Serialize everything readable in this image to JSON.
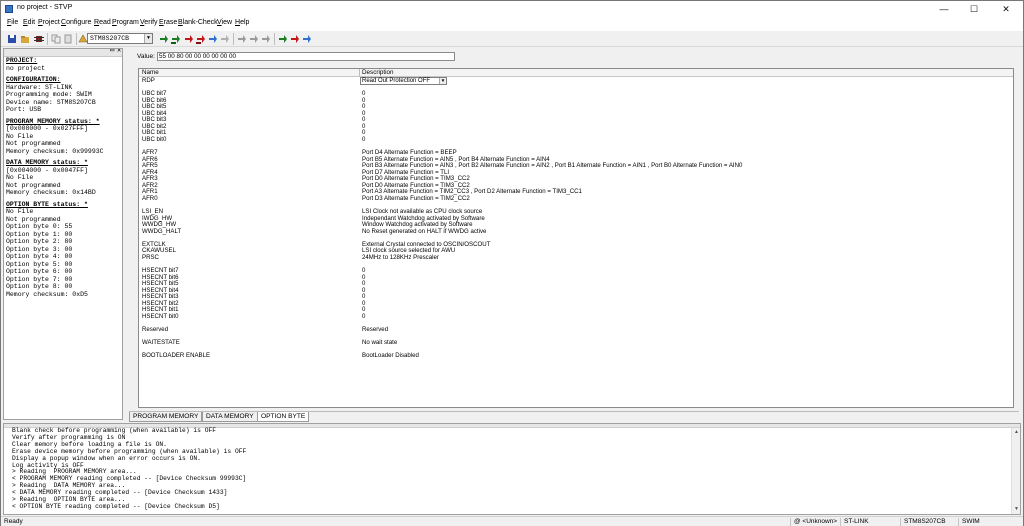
{
  "window": {
    "title": "no project - STVP",
    "min": "—",
    "max": "☐",
    "close": "✕"
  },
  "menu": [
    "File",
    "Edit",
    "Project",
    "Configure",
    "Read",
    "Program",
    "Verify",
    "Erase",
    "Blank-Check",
    "View",
    "Help"
  ],
  "toolbar": {
    "device": "STM8S207CB"
  },
  "left_pane": {
    "sections": [
      {
        "header": "PROJECT:",
        "lines": [
          "no project"
        ]
      },
      {
        "header": "CONFIGURATION:",
        "lines": [
          "Hardware: ST-LINK",
          "Programming mode: SWIM",
          "Device name: STM8S207CB",
          "Port: USB"
        ]
      },
      {
        "header": "PROGRAM MEMORY status: *",
        "lines": [
          "[0x008000 - 0x027FFF]",
          "No File",
          "Not programmed",
          "Memory checksum: 0x99993C"
        ]
      },
      {
        "header": "DATA MEMORY status: *",
        "lines": [
          "[0x004000 - 0x0047FF]",
          "No File",
          "Not programmed",
          "Memory checksum: 0x14BD"
        ]
      },
      {
        "header": "OPTION BYTE status: *",
        "lines": [
          "No File",
          "Not programmed",
          "Option byte 0: 55",
          "Option byte 1: 00",
          "Option byte 2: 80",
          "Option byte 3: 00",
          "Option byte 4: 00",
          "Option byte 5: 00",
          "Option byte 6: 00",
          "Option byte 7: 00",
          "Option byte 8: 00",
          "Memory checksum: 0xD5"
        ]
      }
    ]
  },
  "value": {
    "label": "Value:",
    "text": "55 00 80 00 00 00 00 00 00"
  },
  "grid": {
    "headers": [
      "Name",
      "Description"
    ],
    "rows": [
      {
        "name": "RDP",
        "desc": "Read Out Protection OFF",
        "combo": true
      },
      {
        "name": "",
        "desc": ""
      },
      {
        "name": "UBC bit7",
        "desc": "0"
      },
      {
        "name": "UBC bit6",
        "desc": "0"
      },
      {
        "name": "UBC bit5",
        "desc": "0"
      },
      {
        "name": "UBC bit4",
        "desc": "0"
      },
      {
        "name": "UBC bit3",
        "desc": "0"
      },
      {
        "name": "UBC bit2",
        "desc": "0"
      },
      {
        "name": "UBC bit1",
        "desc": "0"
      },
      {
        "name": "UBC bit0",
        "desc": "0"
      },
      {
        "name": "",
        "desc": ""
      },
      {
        "name": "AFR7",
        "desc": "Port D4 Alternate Function = BEEP"
      },
      {
        "name": "AFR6",
        "desc": "Port B5 Alternate Function = AIN5 , Port B4 Alternate Function = AIN4"
      },
      {
        "name": "AFR5",
        "desc": "Port B3 Alternate Function = AIN3 , Port B2 Alternate Function = AIN2 , Port B1 Alternate Function = AIN1 , Port B0 Alternate Function = AIN0"
      },
      {
        "name": "AFR4",
        "desc": "Port D7 Alternate Function = TLI"
      },
      {
        "name": "AFR3",
        "desc": "Port D0 Alternate Function = TIM3_CC2"
      },
      {
        "name": "AFR2",
        "desc": "Port D0 Alternate Function = TIM3_CC2"
      },
      {
        "name": "AFR1",
        "desc": "Port A3 Alternate Function = TIM2_CC3 , Port D2 Alternate Function = TIM3_CC1"
      },
      {
        "name": "AFR0",
        "desc": "Port D3 Alternate Function = TIM2_CC2"
      },
      {
        "name": "",
        "desc": ""
      },
      {
        "name": "LSI_EN",
        "desc": "LSI Clock not available as CPU clock source"
      },
      {
        "name": "IWDG_HW",
        "desc": "Independant Watchdog activated by Software"
      },
      {
        "name": "WWDG_HW",
        "desc": "Window Watchdog activated by Software"
      },
      {
        "name": "WWDG_HALT",
        "desc": "No Reset generated on HALT if WWDG active"
      },
      {
        "name": "",
        "desc": ""
      },
      {
        "name": "EXTCLK",
        "desc": "External Crystal connected to OSCIN/OSCOUT"
      },
      {
        "name": "CKAWUSEL",
        "desc": "LSI clock source selected for AWU"
      },
      {
        "name": "PRSC",
        "desc": "24MHz to 128KHz Prescaler"
      },
      {
        "name": "",
        "desc": ""
      },
      {
        "name": "HSECNT bit7",
        "desc": "0"
      },
      {
        "name": "HSECNT bit6",
        "desc": "0"
      },
      {
        "name": "HSECNT bit5",
        "desc": "0"
      },
      {
        "name": "HSECNT bit4",
        "desc": "0"
      },
      {
        "name": "HSECNT bit3",
        "desc": "0"
      },
      {
        "name": "HSECNT bit2",
        "desc": "0"
      },
      {
        "name": "HSECNT bit1",
        "desc": "0"
      },
      {
        "name": "HSECNT bit0",
        "desc": "0"
      },
      {
        "name": "",
        "desc": ""
      },
      {
        "name": "Reserved",
        "desc": "Reserved"
      },
      {
        "name": "",
        "desc": ""
      },
      {
        "name": "WAITESTATE",
        "desc": "No wait state"
      },
      {
        "name": "",
        "desc": ""
      },
      {
        "name": "BOOTLOADER ENABLE",
        "desc": "BootLoader Disabled"
      }
    ]
  },
  "tabs": [
    {
      "label": "PROGRAM MEMORY",
      "active": false
    },
    {
      "label": "DATA MEMORY",
      "active": false
    },
    {
      "label": "OPTION BYTE",
      "active": true
    }
  ],
  "log": [
    "Blank check before programming (when available) is OFF",
    "Verify after programming is ON",
    "Clear memory before loading a file is ON.",
    "Erase device memory before programming (when available) is OFF",
    "Display a popup window when an error occurs is ON.",
    "Log activity is OFF",
    "> Reading  PROGRAM MEMORY area...",
    "< PROGRAM MEMORY reading completed -- [Device Checksum 99993C]",
    "> Reading  DATA MEMORY area...",
    "< DATA MEMORY reading completed -- [Device Checksum 1433]",
    "> Reading  OPTION BYTE area...",
    "< OPTION BYTE reading completed -- [Device Checksum D5]"
  ],
  "status": {
    "ready": "Ready",
    "file": "@ <Unknown>",
    "link": "ST-LINK",
    "device": "STM8S207CB",
    "mode": "SWIM"
  },
  "colors": {
    "open": "#d8a63a",
    "save": "#2a4ea8",
    "read": "#1a7f22",
    "program": "#c01818",
    "verify": "#2e6fcf",
    "erase": "#808080"
  }
}
